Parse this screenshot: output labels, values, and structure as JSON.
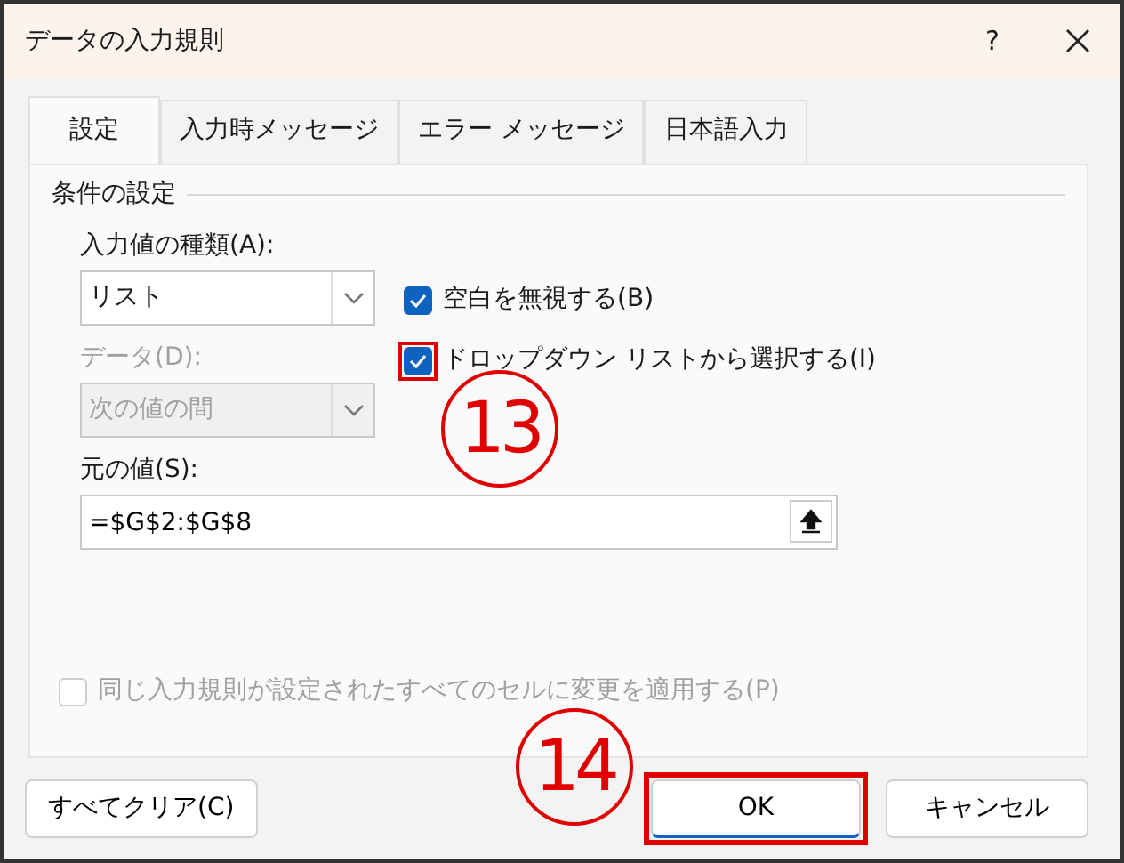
{
  "window": {
    "title": "データの入力規則",
    "help": "?"
  },
  "tabs": [
    {
      "label": "設定",
      "selected": true
    },
    {
      "label": "入力時メッセージ",
      "selected": false
    },
    {
      "label": "エラー メッセージ",
      "selected": false
    },
    {
      "label": "日本語入力",
      "selected": false
    }
  ],
  "group_title": "条件の設定",
  "allow": {
    "label": "入力値の種類(A):",
    "value": "リスト",
    "disabled": false
  },
  "checkboxes": [
    {
      "label": "空白を無視する(B)",
      "checked": true,
      "disabled": false,
      "highlighted": false
    },
    {
      "label": "ドロップダウン リストから選択する(I)",
      "checked": true,
      "disabled": false,
      "highlighted": true
    }
  ],
  "data": {
    "label": "データ(D):",
    "value": "次の値の間",
    "disabled": true
  },
  "source": {
    "label": "元の値(S):",
    "value": "=$G$2:$G$8"
  },
  "apply_all": {
    "label": "同じ入力規則が設定されたすべてのセルに変更を適用する(P)",
    "checked": false,
    "disabled": true,
    "highlighted": false
  },
  "buttons": [
    {
      "label": "すべてクリア(C)",
      "kind": "left",
      "default": false,
      "highlighted": false
    },
    {
      "label": "OK",
      "kind": "right",
      "default": true,
      "highlighted": true
    },
    {
      "label": "キャンセル",
      "kind": "right",
      "default": false,
      "highlighted": false
    }
  ],
  "annotations": [
    {
      "text": "13"
    },
    {
      "text": "14"
    }
  ]
}
